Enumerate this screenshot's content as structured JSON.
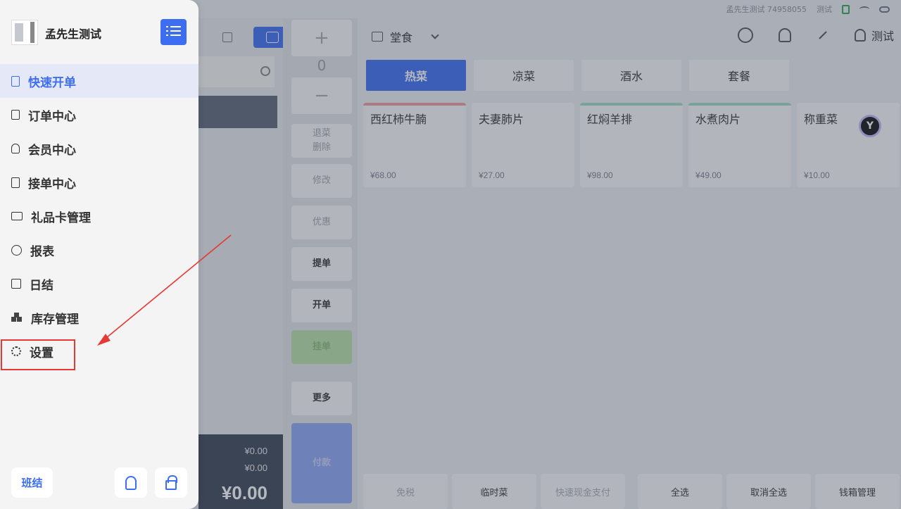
{
  "statusbar": {
    "account": "孟先生测试 74958055",
    "user": "测试"
  },
  "drawer": {
    "store_name": "孟先生测试",
    "nav": [
      {
        "label": "快速开单",
        "icon": "doc-plus-icon",
        "active": true
      },
      {
        "label": "订单中心",
        "icon": "list-doc-icon"
      },
      {
        "label": "会员中心",
        "icon": "user-icon"
      },
      {
        "label": "接单中心",
        "icon": "clipboard-icon"
      },
      {
        "label": "礼品卡管理",
        "icon": "card-icon"
      },
      {
        "label": "报表",
        "icon": "pie-chart-icon"
      },
      {
        "label": "日结",
        "icon": "calendar-list-icon"
      },
      {
        "label": "库存管理",
        "icon": "boxes-icon"
      },
      {
        "label": "设置",
        "icon": "gear-icon"
      }
    ],
    "shift_label": "班结"
  },
  "order": {
    "amount_1": "¥0.00",
    "amount_2": "¥0.00",
    "total": "¥0.00"
  },
  "actions": {
    "plus": "+",
    "qty": "0",
    "minus": "−",
    "void": "退菜\n删除",
    "modify": "修改",
    "discount": "优惠",
    "submit": "提单",
    "open": "开单",
    "green_btn": "挂单",
    "more": "更多",
    "pay": "付款"
  },
  "menu": {
    "dine_type": "堂食",
    "user": "测试",
    "categories": [
      "热菜",
      "凉菜",
      "酒水",
      "套餐"
    ],
    "dishes": [
      {
        "name": "西红柿牛腩",
        "price": "¥68.00",
        "accent": "#e8a0a0"
      },
      {
        "name": "夫妻肺片",
        "price": "¥27.00",
        "accent": ""
      },
      {
        "name": "红焖羊排",
        "price": "¥98.00",
        "accent": "#9fdcc6"
      },
      {
        "name": "水煮肉片",
        "price": "¥49.00",
        "accent": "#9fdcc6"
      },
      {
        "name": "称重菜",
        "price": "¥10.00",
        "accent": ""
      }
    ],
    "bottom": [
      "免税",
      "临时菜",
      "快速现金支付",
      "全选",
      "取消全选",
      "钱箱管理"
    ]
  },
  "colors": {
    "accent": "#3d6ef2",
    "highlight": "#e53935"
  }
}
